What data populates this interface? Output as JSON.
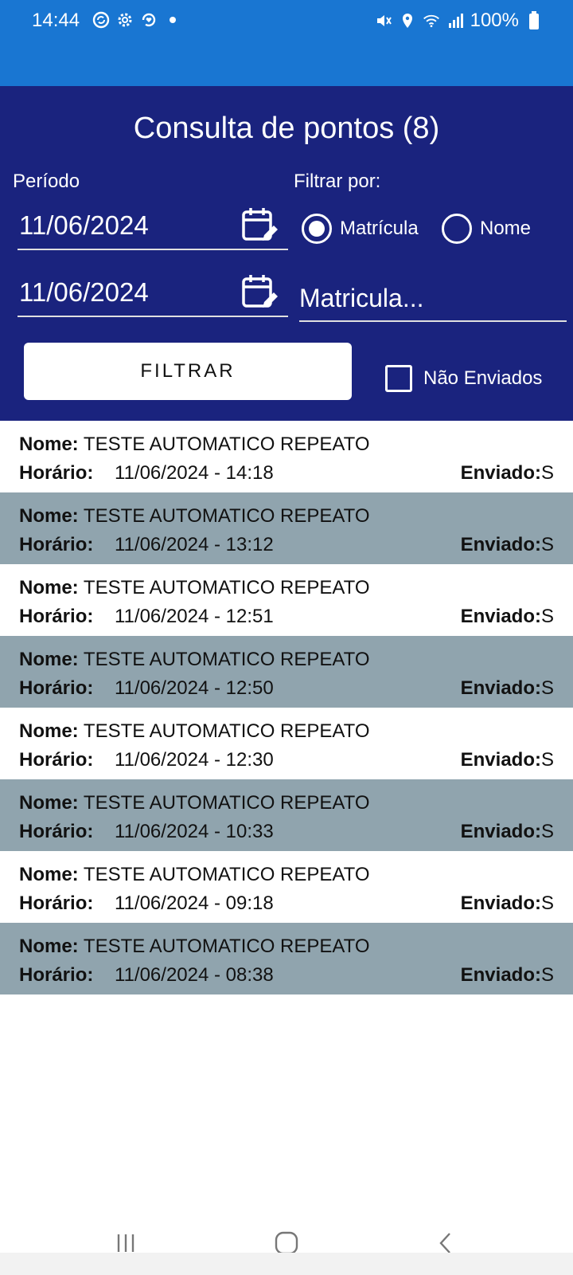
{
  "status_bar": {
    "time": "14:44",
    "battery": "100%",
    "left_icons": [
      "sync-icon",
      "gear-icon",
      "heart-sync-icon",
      "dot-icon"
    ],
    "right_icons": [
      "mute-icon",
      "location-icon",
      "wifi-icon",
      "signal-icon",
      "battery-icon"
    ]
  },
  "panel": {
    "title": "Consulta de pontos (8)",
    "period_label": "Período",
    "filter_label": "Filtrar por:",
    "date_start": "11/06/2024",
    "date_end": "11/06/2024",
    "radio_matricula": "Matrícula",
    "radio_nome": "Nome",
    "radio_selected": "Matrícula",
    "search_placeholder": "Matricula...",
    "filter_button": "FILTRAR",
    "not_sent_label": "Não Enviados",
    "not_sent_checked": false
  },
  "list": {
    "name_label": "Nome:",
    "time_label": "Horário:",
    "sent_label": "Enviado:",
    "items": [
      {
        "name": "TESTE AUTOMATICO REPEATO",
        "time": "11/06/2024 - 14:18",
        "sent": "S"
      },
      {
        "name": "TESTE AUTOMATICO REPEATO",
        "time": "11/06/2024 - 13:12",
        "sent": "S"
      },
      {
        "name": "TESTE AUTOMATICO REPEATO",
        "time": "11/06/2024 - 12:51",
        "sent": "S"
      },
      {
        "name": "TESTE AUTOMATICO REPEATO",
        "time": "11/06/2024 - 12:50",
        "sent": "S"
      },
      {
        "name": "TESTE AUTOMATICO REPEATO",
        "time": "11/06/2024 - 12:30",
        "sent": "S"
      },
      {
        "name": "TESTE AUTOMATICO REPEATO",
        "time": "11/06/2024 - 10:33",
        "sent": "S"
      },
      {
        "name": "TESTE AUTOMATICO REPEATO",
        "time": "11/06/2024 - 09:18",
        "sent": "S"
      },
      {
        "name": "TESTE AUTOMATICO REPEATO",
        "time": "11/06/2024 - 08:38",
        "sent": "S"
      }
    ]
  },
  "colors": {
    "status_bar": "#1976d2",
    "panel": "#1a237e",
    "row_alt": "#90a4ae",
    "row_plain": "#ffffff"
  },
  "nav": {
    "icons": [
      "recent-apps-icon",
      "home-icon",
      "back-icon"
    ]
  }
}
